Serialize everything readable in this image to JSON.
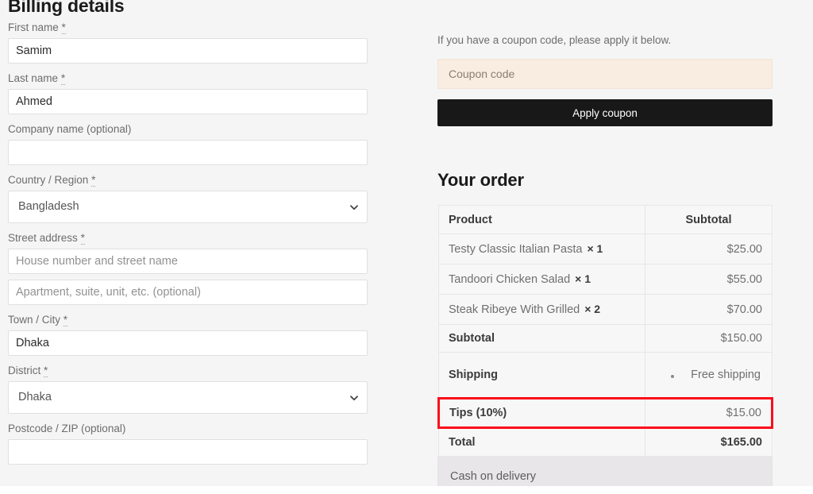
{
  "billing": {
    "heading": "Billing details",
    "fields": [
      {
        "label": "First name",
        "required": true,
        "type": "text",
        "value": "Samim",
        "placeholder": ""
      },
      {
        "label": "Last name",
        "required": true,
        "type": "text",
        "value": "Ahmed",
        "placeholder": ""
      },
      {
        "label": "Company name (optional)",
        "required": false,
        "type": "text",
        "value": "",
        "placeholder": ""
      },
      {
        "label": "Country / Region",
        "required": true,
        "type": "select",
        "value": "Bangladesh",
        "placeholder": ""
      },
      {
        "label": "Street address",
        "required": true,
        "type": "text",
        "value": "",
        "placeholder": "House number and street name"
      },
      {
        "label": "",
        "required": false,
        "type": "text",
        "value": "",
        "placeholder": "Apartment, suite, unit, etc. (optional)"
      },
      {
        "label": "Town / City",
        "required": true,
        "type": "text",
        "value": "Dhaka",
        "placeholder": ""
      },
      {
        "label": "District",
        "required": true,
        "type": "select",
        "value": "Dhaka",
        "placeholder": ""
      },
      {
        "label": "Postcode / ZIP (optional)",
        "required": false,
        "type": "text",
        "value": "",
        "placeholder": ""
      }
    ],
    "required_marker": "*"
  },
  "coupon": {
    "note": "If you have a coupon code, please apply it below.",
    "placeholder": "Coupon code",
    "value": "",
    "apply_label": "Apply coupon",
    "input_bg": "#f9ece0",
    "button_bg": "#181818"
  },
  "order": {
    "heading": "Your order",
    "columns": {
      "product": "Product",
      "subtotal": "Subtotal"
    },
    "items": [
      {
        "name": "Testy Classic Italian Pasta",
        "qty": "× 1",
        "amount": "$25.00"
      },
      {
        "name": "Tandoori Chicken Salad",
        "qty": "× 1",
        "amount": "$55.00"
      },
      {
        "name": "Steak Ribeye With Grilled",
        "qty": "× 2",
        "amount": "$70.00"
      }
    ],
    "subtotal": {
      "label": "Subtotal",
      "amount": "$150.00"
    },
    "shipping": {
      "label": "Shipping",
      "option": "Free shipping"
    },
    "tips": {
      "label": "Tips (10%)",
      "amount": "$15.00",
      "highlight_color": "#fc0d1b"
    },
    "total": {
      "label": "Total",
      "amount": "$165.00"
    },
    "payment": {
      "method": "Cash on delivery"
    }
  }
}
